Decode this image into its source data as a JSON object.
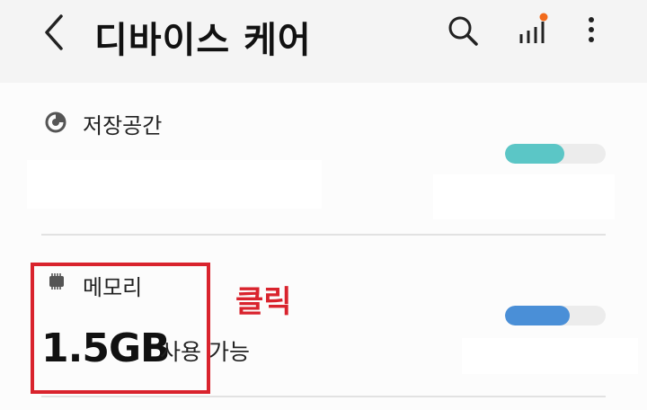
{
  "header": {
    "title": "디바이스 케어",
    "icons": [
      "back-arrow-icon",
      "search-icon",
      "signal-bars-icon",
      "more-vertical-icon"
    ],
    "notification_dot_color": "#f26a1b"
  },
  "storage": {
    "label": "저장공간",
    "icon": "pie-chart-icon",
    "usage_fraction": 0.59,
    "bar_color": "#5bc6c6"
  },
  "memory": {
    "label": "메모리",
    "icon": "memory-chip-icon",
    "value": "1.5GB",
    "value_suffix": "사용 가능",
    "usage_fraction": 0.64,
    "bar_color": "#4a8fd7"
  },
  "annotation": {
    "note": "클릭",
    "color": "#d9232d"
  }
}
